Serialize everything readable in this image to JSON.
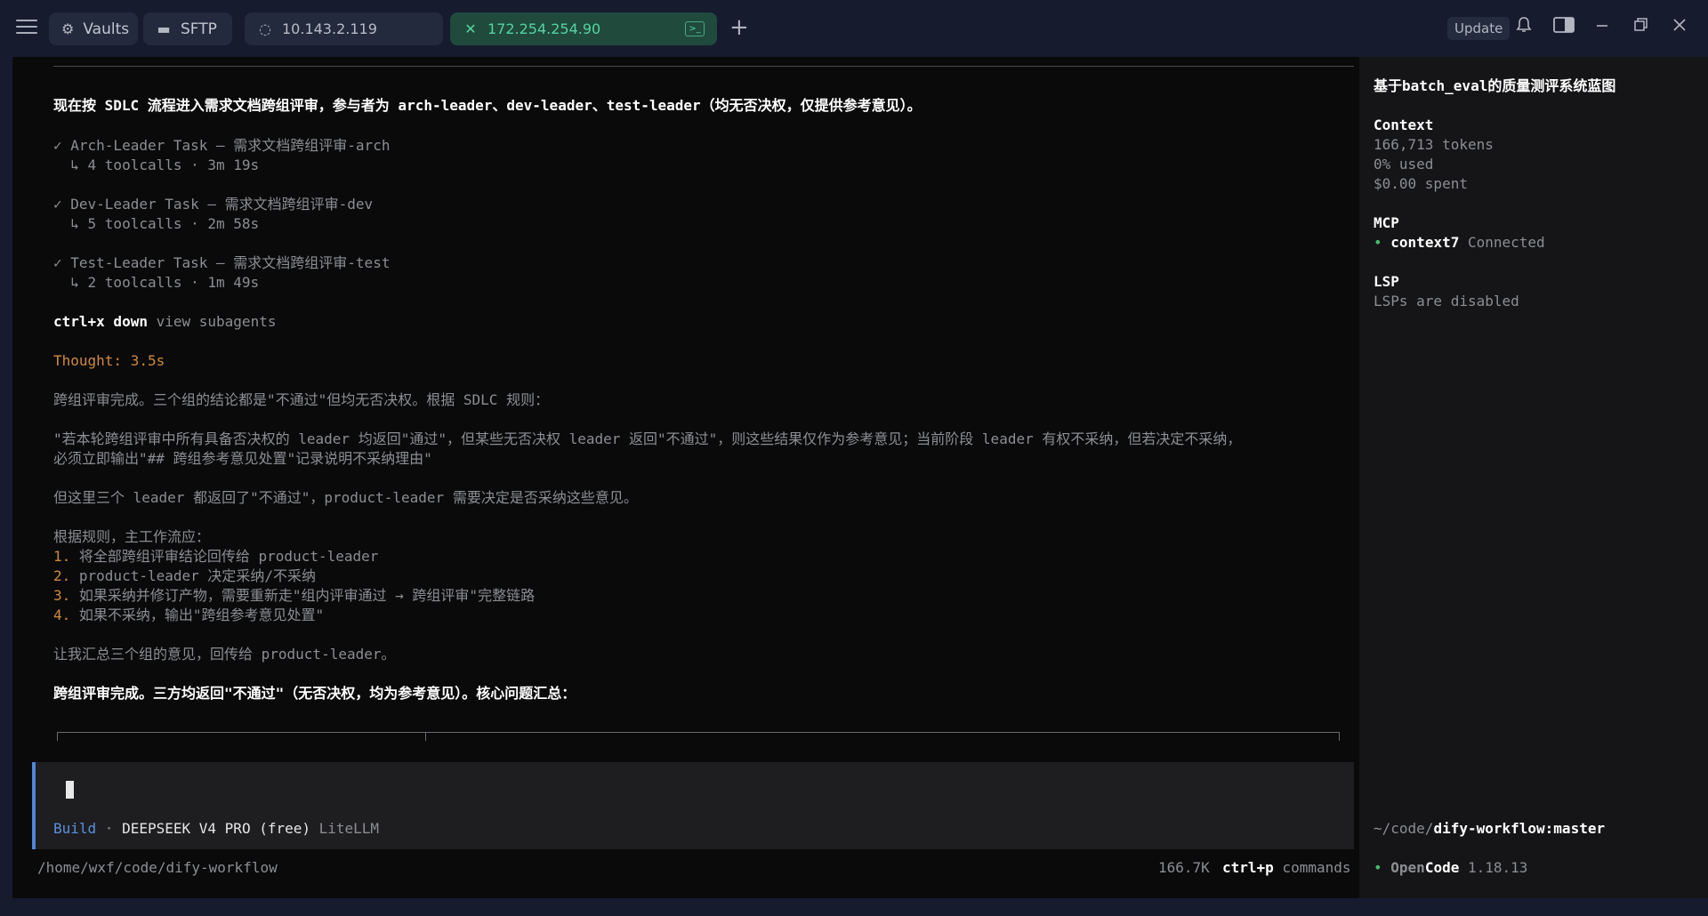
{
  "tabs": {
    "vaults": "Vaults",
    "sftp": "SFTP",
    "host1": "10.143.2.119",
    "host2": "172.254.254.90",
    "update": "Update"
  },
  "terminal": {
    "intro": "现在按 SDLC 流程进入需求文档跨组评审，参与者为 arch-leader、dev-leader、test-leader（均无否决权，仅提供参考意见）。",
    "tasks": [
      {
        "title": "✓ Arch-Leader Task — 需求文档跨组评审-arch",
        "meta": "  ↳ 4 toolcalls · 3m 19s"
      },
      {
        "title": "✓ Dev-Leader Task — 需求文档跨组评审-dev",
        "meta": "  ↳ 5 toolcalls · 2m 58s"
      },
      {
        "title": "✓ Test-Leader Task — 需求文档跨组评审-test",
        "meta": "  ↳ 2 toolcalls · 1m 49s"
      }
    ],
    "shortcut_key": "ctrl+x down",
    "shortcut_label": " view subagents",
    "thought": "Thought: 3.5s",
    "p1": "跨组评审完成。三个组的结论都是\"不通过\"但均无否决权。根据 SDLC 规则：",
    "p2a": "\"若本轮跨组评审中所有具备否决权的 leader 均返回\"通过\"，但某些无否决权 leader 返回\"不通过\"，则这些结果仅作为参考意见；当前阶段 leader 有权不采纳，但若决定不采纳，",
    "p2b": "必须立即输出\"## 跨组参考意见处置\"记录说明不采纳理由\"",
    "p3": "但这里三个 leader 都返回了\"不通过\"，product-leader 需要决定是否采纳这些意见。",
    "p4": "根据规则，主工作流应：",
    "steps": [
      {
        "num": "1.",
        "text": " 将全部跨组评审结论回传给 product-leader"
      },
      {
        "num": "2.",
        "text": " product-leader 决定采纳/不采纳"
      },
      {
        "num": "3.",
        "text": " 如果采纳并修订产物，需要重新走\"组内评审通过 → 跨组评审\"完整链路"
      },
      {
        "num": "4.",
        "text": " 如果不采纳，输出\"跨组参考意见处置\""
      }
    ],
    "p5": "让我汇总三个组的意见，回传给 product-leader。",
    "summary": "跨组评审完成。三方均返回\"不通过\"（无否决权，均为参考意见）。核心问题汇总："
  },
  "input": {
    "mode": "Build",
    "separator": " · ",
    "model": "DEEPSEEK V4 PRO (free)",
    "provider": " LiteLLM"
  },
  "status": {
    "path": "/home/wxf/code/dify-workflow",
    "tokens": "166.7K",
    "cmd_key": "ctrl+p",
    "cmd_label": " commands"
  },
  "sidebar": {
    "title": "基于batch_eval的质量测评系统蓝图",
    "context_heading": "Context",
    "tokens": "166,713 tokens",
    "used": "0% used",
    "spent": "$0.00 spent",
    "mcp_heading": "MCP",
    "mcp_bullet": "•",
    "mcp_name": "context7",
    "mcp_status": " Connected",
    "lsp_heading": "LSP",
    "lsp_status": "LSPs are disabled",
    "cwd_prefix": "~/code/",
    "cwd_branch": "dify-workflow:master",
    "app_bullet": "•",
    "app_name_a": "Open",
    "app_name_b": "Code",
    "app_version": " 1.18.13"
  },
  "colors": {
    "accent_blue": "#4e86d8",
    "thought_orange": "#d08a3e",
    "active_tab_green": "#57d3a2",
    "mcp_green": "#3fbf6f"
  }
}
